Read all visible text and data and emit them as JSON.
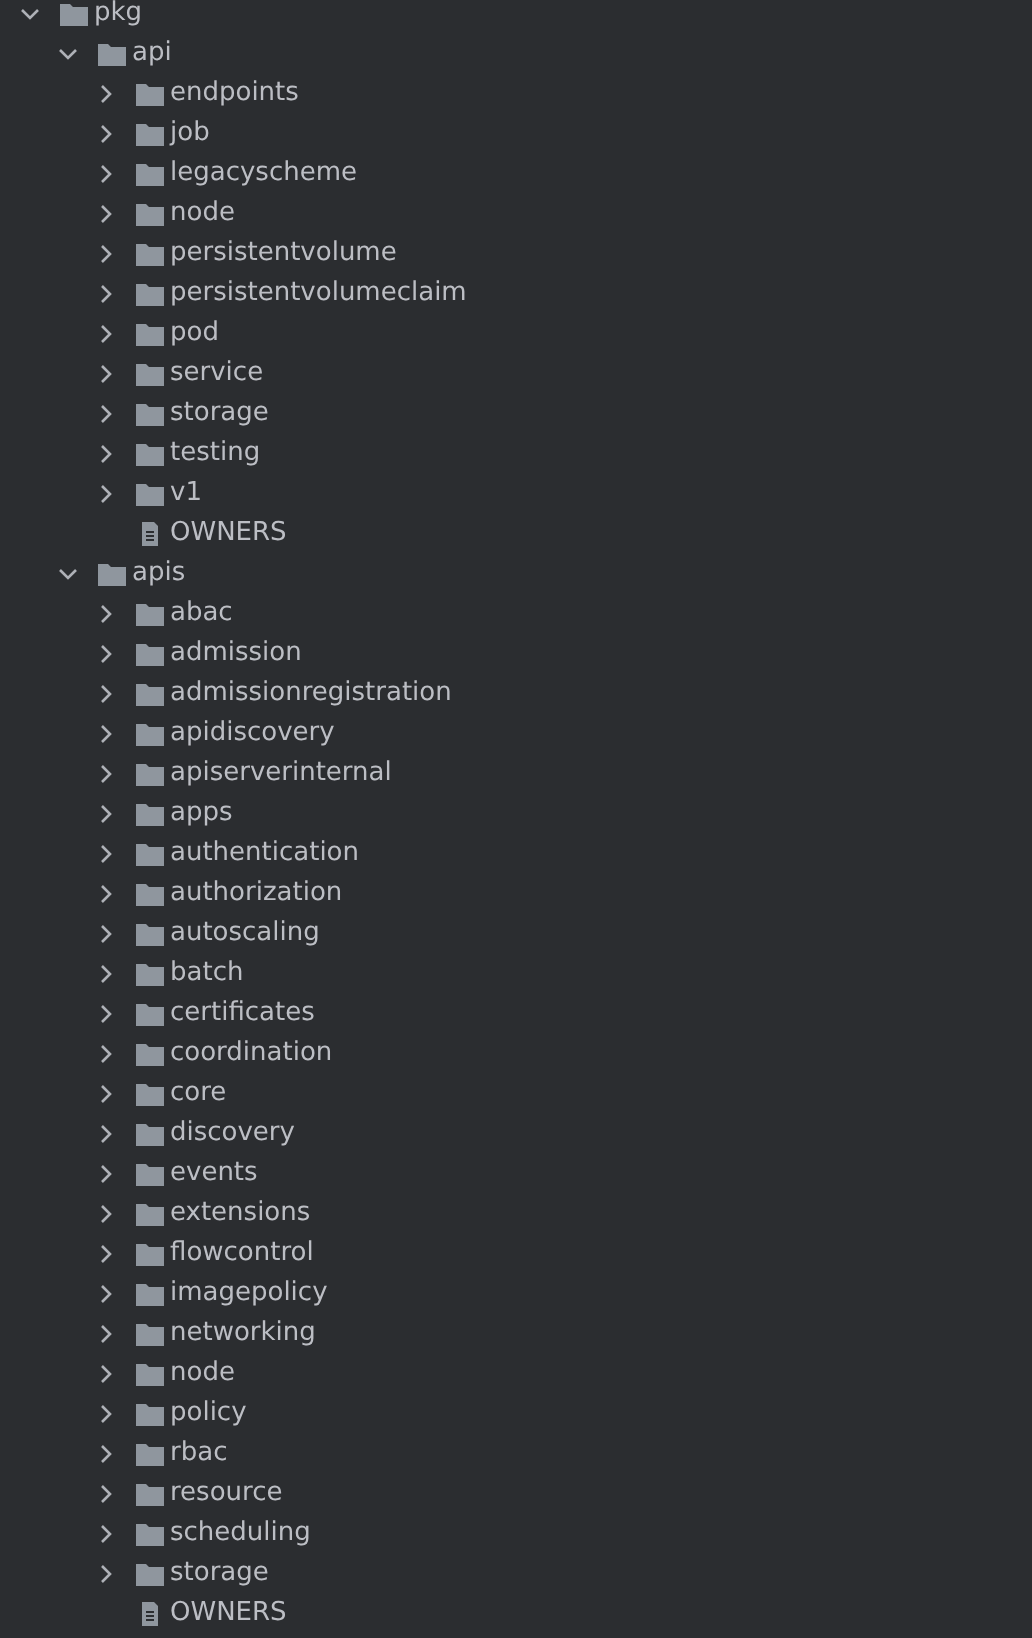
{
  "tree": [
    {
      "kind": "folder",
      "name": "pkg",
      "expanded": true,
      "children": [
        {
          "kind": "folder",
          "name": "api",
          "expanded": true,
          "children": [
            {
              "kind": "folder",
              "name": "endpoints",
              "expanded": false
            },
            {
              "kind": "folder",
              "name": "job",
              "expanded": false
            },
            {
              "kind": "folder",
              "name": "legacyscheme",
              "expanded": false
            },
            {
              "kind": "folder",
              "name": "node",
              "expanded": false
            },
            {
              "kind": "folder",
              "name": "persistentvolume",
              "expanded": false
            },
            {
              "kind": "folder",
              "name": "persistentvolumeclaim",
              "expanded": false
            },
            {
              "kind": "folder",
              "name": "pod",
              "expanded": false
            },
            {
              "kind": "folder",
              "name": "service",
              "expanded": false
            },
            {
              "kind": "folder",
              "name": "storage",
              "expanded": false
            },
            {
              "kind": "folder",
              "name": "testing",
              "expanded": false
            },
            {
              "kind": "folder",
              "name": "v1",
              "expanded": false
            },
            {
              "kind": "file",
              "name": "OWNERS"
            }
          ]
        },
        {
          "kind": "folder",
          "name": "apis",
          "expanded": true,
          "children": [
            {
              "kind": "folder",
              "name": "abac",
              "expanded": false
            },
            {
              "kind": "folder",
              "name": "admission",
              "expanded": false
            },
            {
              "kind": "folder",
              "name": "admissionregistration",
              "expanded": false
            },
            {
              "kind": "folder",
              "name": "apidiscovery",
              "expanded": false
            },
            {
              "kind": "folder",
              "name": "apiserverinternal",
              "expanded": false
            },
            {
              "kind": "folder",
              "name": "apps",
              "expanded": false
            },
            {
              "kind": "folder",
              "name": "authentication",
              "expanded": false
            },
            {
              "kind": "folder",
              "name": "authorization",
              "expanded": false
            },
            {
              "kind": "folder",
              "name": "autoscaling",
              "expanded": false
            },
            {
              "kind": "folder",
              "name": "batch",
              "expanded": false
            },
            {
              "kind": "folder",
              "name": "certificates",
              "expanded": false
            },
            {
              "kind": "folder",
              "name": "coordination",
              "expanded": false
            },
            {
              "kind": "folder",
              "name": "core",
              "expanded": false
            },
            {
              "kind": "folder",
              "name": "discovery",
              "expanded": false
            },
            {
              "kind": "folder",
              "name": "events",
              "expanded": false
            },
            {
              "kind": "folder",
              "name": "extensions",
              "expanded": false
            },
            {
              "kind": "folder",
              "name": "flowcontrol",
              "expanded": false
            },
            {
              "kind": "folder",
              "name": "imagepolicy",
              "expanded": false
            },
            {
              "kind": "folder",
              "name": "networking",
              "expanded": false
            },
            {
              "kind": "folder",
              "name": "node",
              "expanded": false
            },
            {
              "kind": "folder",
              "name": "policy",
              "expanded": false
            },
            {
              "kind": "folder",
              "name": "rbac",
              "expanded": false
            },
            {
              "kind": "folder",
              "name": "resource",
              "expanded": false
            },
            {
              "kind": "folder",
              "name": "scheduling",
              "expanded": false
            },
            {
              "kind": "folder",
              "name": "storage",
              "expanded": false
            },
            {
              "kind": "file",
              "name": "OWNERS"
            }
          ]
        }
      ]
    }
  ]
}
